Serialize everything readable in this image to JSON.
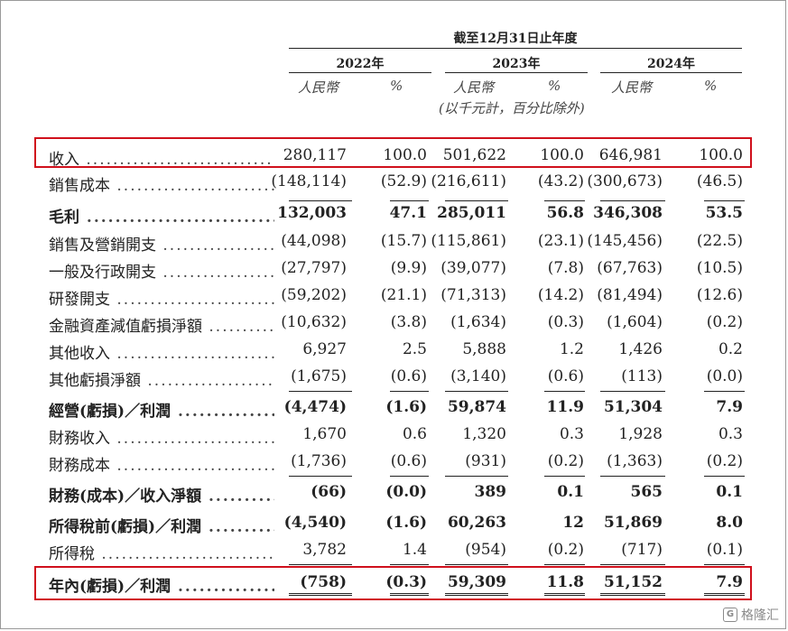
{
  "header": {
    "period": "截至12月31日止年度",
    "years": [
      "2022年",
      "2023年",
      "2024年"
    ],
    "unit_rmb": "人民幣",
    "unit_pct": "%",
    "note": "(以千元計，百分比除外)"
  },
  "rows": [
    {
      "label": "收入",
      "values": [
        "280,117",
        "100.0",
        "501,622",
        "100.0",
        "646,981",
        "100.0"
      ],
      "bold": false,
      "highlight": true
    },
    {
      "label": "銷售成本",
      "values": [
        "(148,114)",
        "(52.9)",
        "(216,611)",
        "(43.2)",
        "(300,673)",
        "(46.5)"
      ],
      "bold": false
    },
    {
      "label": "毛利",
      "values": [
        "132,003",
        "47.1",
        "285,011",
        "56.8",
        "346,308",
        "53.5"
      ],
      "bold": true
    },
    {
      "label": "銷售及營銷開支",
      "values": [
        "(44,098)",
        "(15.7)",
        "(115,861)",
        "(23.1)",
        "(145,456)",
        "(22.5)"
      ],
      "bold": false
    },
    {
      "label": "一般及行政開支",
      "values": [
        "(27,797)",
        "(9.9)",
        "(39,077)",
        "(7.8)",
        "(67,763)",
        "(10.5)"
      ],
      "bold": false
    },
    {
      "label": "研發開支",
      "values": [
        "(59,202)",
        "(21.1)",
        "(71,313)",
        "(14.2)",
        "(81,494)",
        "(12.6)"
      ],
      "bold": false
    },
    {
      "label": "金融資產減值虧損淨額",
      "values": [
        "(10,632)",
        "(3.8)",
        "(1,634)",
        "(0.3)",
        "(1,604)",
        "(0.2)"
      ],
      "bold": false
    },
    {
      "label": "其他收入",
      "values": [
        "6,927",
        "2.5",
        "5,888",
        "1.2",
        "1,426",
        "0.2"
      ],
      "bold": false
    },
    {
      "label": "其他虧損淨額",
      "values": [
        "(1,675)",
        "(0.6)",
        "(3,140)",
        "(0.6)",
        "(113)",
        "(0.0)"
      ],
      "bold": false
    },
    {
      "label": "經營(虧損)／利潤",
      "values": [
        "(4,474)",
        "(1.6)",
        "59,874",
        "11.9",
        "51,304",
        "7.9"
      ],
      "bold": true
    },
    {
      "label": "財務收入",
      "values": [
        "1,670",
        "0.6",
        "1,320",
        "0.3",
        "1,928",
        "0.3"
      ],
      "bold": false
    },
    {
      "label": "財務成本",
      "values": [
        "(1,736)",
        "(0.6)",
        "(931)",
        "(0.2)",
        "(1,363)",
        "(0.2)"
      ],
      "bold": false
    },
    {
      "label": "財務(成本)／收入淨額",
      "values": [
        "(66)",
        "(0.0)",
        "389",
        "0.1",
        "565",
        "0.1"
      ],
      "bold": true
    },
    {
      "label": "所得稅前(虧損)／利潤",
      "values": [
        "(4,540)",
        "(1.6)",
        "60,263",
        "12",
        "51,869",
        "8.0"
      ],
      "bold": true
    },
    {
      "label": "所得稅",
      "values": [
        "3,782",
        "1.4",
        "(954)",
        "(0.2)",
        "(717)",
        "(0.1)"
      ],
      "bold": false
    },
    {
      "label": "年內(虧損)／利潤",
      "values": [
        "(758)",
        "(0.3)",
        "59,309",
        "11.8",
        "51,152",
        "7.9"
      ],
      "bold": true,
      "highlight": true
    }
  ],
  "watermark": {
    "icon": "G",
    "text": "格隆汇"
  },
  "colors": {
    "highlight": "#d0101c",
    "text": "#222222"
  }
}
